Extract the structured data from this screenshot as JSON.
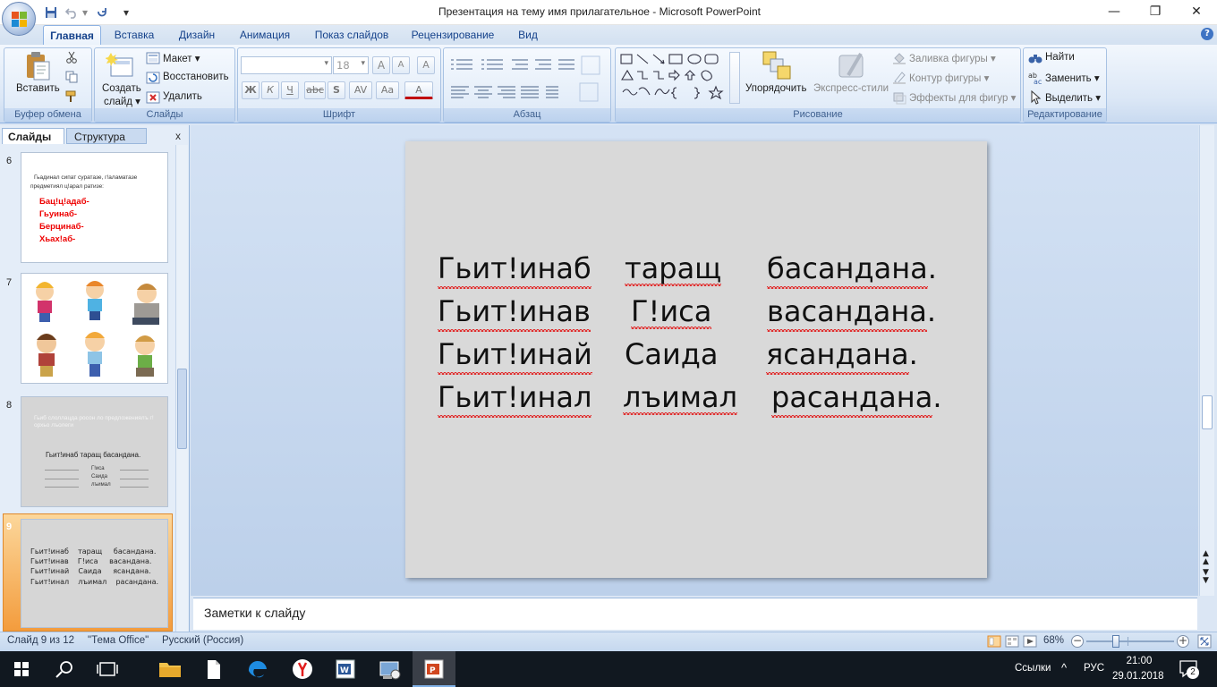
{
  "window": {
    "title": "Презентация на тему имя прилагательное - Microsoft PowerPoint",
    "min_glyph": "—",
    "max_glyph": "❐",
    "close_glyph": "✕"
  },
  "qat": {
    "dropdown_glyph": "▾"
  },
  "tabs": [
    "Главная",
    "Вставка",
    "Дизайн",
    "Анимация",
    "Показ слайдов",
    "Рецензирование",
    "Вид"
  ],
  "help_glyph": "?",
  "ribbon": {
    "clipboard": {
      "paste": "Вставить",
      "group": "Буфер обмена"
    },
    "slides": {
      "new_slide": "Создать",
      "new_slide2": "слайд ▾",
      "layout": "Макет ▾",
      "reset": "Восстановить",
      "delete": "Удалить",
      "group": "Слайды"
    },
    "font": {
      "font_size": "18",
      "bold": "Ж",
      "italic": "К",
      "underline": "Ч",
      "strike": "abc",
      "shadow": "S",
      "spacing": "AV",
      "case": "Aa",
      "color": "A",
      "grow": "A",
      "shrink": "A",
      "clear": "A",
      "group": "Шрифт"
    },
    "paragraph": {
      "group": "Абзац"
    },
    "drawing": {
      "arrange": "Упорядочить",
      "quick_styles": "Экспресс-стили",
      "fill": "Заливка фигуры ▾",
      "outline": "Контур фигуры ▾",
      "effects": "Эффекты для фигур ▾",
      "group": "Рисование"
    },
    "editing": {
      "find": "Найти",
      "replace": "Заменить ▾",
      "select": "Выделить ▾",
      "group": "Редактирование"
    }
  },
  "left_pane": {
    "tab_slides": "Слайды",
    "tab_outline": "Структура",
    "close_glyph": "x",
    "thumbnails": [
      {
        "num": "6",
        "lines": [
          "Гьадинал сипат суратазе, г!аламатазе",
          "предметиял ц!арал ратизе:"
        ],
        "red_lines": [
          "Бац!ц!адаб-",
          "Гьуинаб-",
          "Берцинаб-",
          "Хьах!аб-"
        ]
      },
      {
        "num": "7"
      },
      {
        "num": "8",
        "title": "Гьиб слоллацда росон ло предложениялъ г!орхьо лъолеги",
        "sentence": "Гьит!инаб  таращ басандана.",
        "words": [
          "Г!иса",
          "Саида",
          "лъимал"
        ]
      },
      {
        "num": "9",
        "lines": [
          "Гьит!инаб    таращ     басандана.",
          "Гьит!инав    Г!иса     васандана.",
          "Гьит!инай    Саида     ясандана.",
          "Гьит!инал    лъимал    расандана."
        ]
      }
    ]
  },
  "slide": {
    "rows": [
      [
        "Гьит!инаб",
        "таращ",
        "басандана",
        "."
      ],
      [
        "Гьит!инав",
        "Г!иса",
        "васандана",
        "."
      ],
      [
        "Гьит!инай",
        "Саида",
        "ясандана",
        "."
      ],
      [
        "Гьит!инал",
        "лъимал",
        "расандана",
        "."
      ]
    ]
  },
  "notes": {
    "placeholder": "Заметки к слайду"
  },
  "status": {
    "slide": "Слайд 9 из 12",
    "theme": "\"Тема Office\"",
    "language": "Русский (Россия)",
    "zoom": "68%",
    "zoom_level": 0.68
  },
  "taskbar": {
    "links": "Ссылки",
    "lang": "РУС",
    "time": "21:00",
    "date": "29.01.2018",
    "notif_count": "2",
    "chevron": "^"
  },
  "colors": {
    "accent": "#15428b",
    "red_text": "#e00000",
    "active_thumb": "#f9b35d"
  }
}
